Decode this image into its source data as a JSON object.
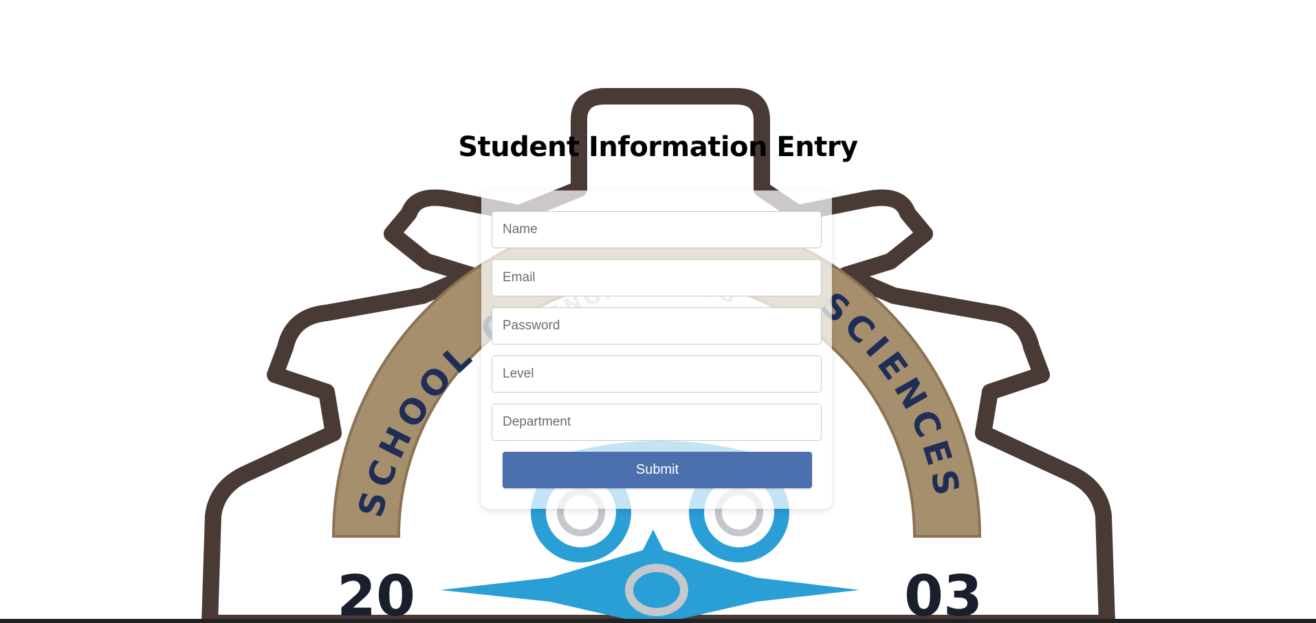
{
  "page": {
    "title": "Student Information Entry"
  },
  "form": {
    "fields": [
      {
        "name": "name",
        "placeholder": "Name",
        "value": ""
      },
      {
        "name": "email",
        "placeholder": "Email",
        "value": ""
      },
      {
        "name": "password",
        "placeholder": "Password",
        "value": ""
      },
      {
        "name": "level",
        "placeholder": "Level",
        "value": ""
      },
      {
        "name": "department",
        "placeholder": "Department",
        "value": ""
      }
    ],
    "submit_label": "Submit"
  },
  "emblem": {
    "text_left": "SCHOOL O",
    "text_right": "SCIENCES",
    "text_top": "ENGINEERING",
    "year_left": "20",
    "year_right": "03",
    "icons": [
      "gear-outline-icon",
      "adinkra-symbol-icon"
    ]
  },
  "colors": {
    "submit_button": "#4b70ad",
    "gear_outline": "#4a3a36",
    "emblem_band": "#a58f6d",
    "emblem_blue": "#2a9fd6",
    "bottom_bar": "#222222"
  }
}
